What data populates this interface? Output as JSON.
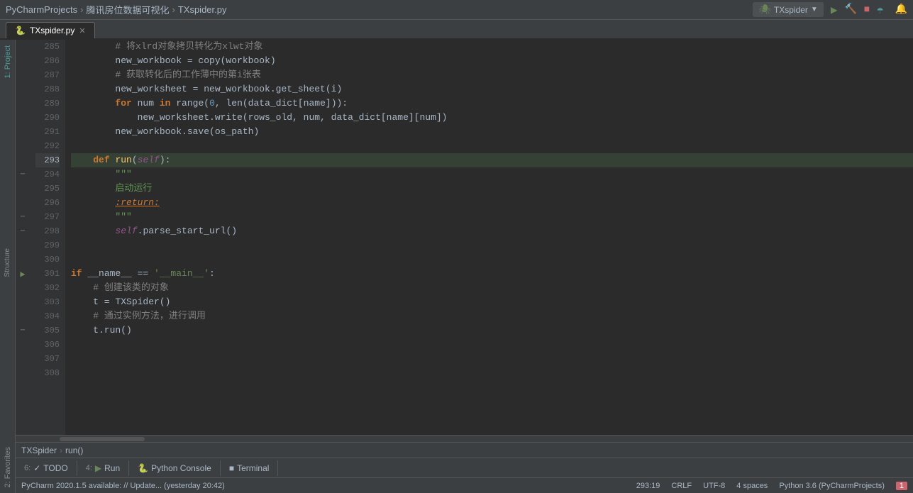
{
  "titlebar": {
    "project": "PyCharmProjects",
    "sep1": "›",
    "folder": "腾讯房位数据可视化",
    "sep2": "›",
    "file": "TXspider.py",
    "run_config_label": "TXspider",
    "run_icon": "▶",
    "build_icon": "🔨",
    "stop_icon": "⏹",
    "coverage_icon": "☂"
  },
  "tabs": [
    {
      "label": "TXspider.py",
      "icon": "🐍",
      "active": true
    }
  ],
  "editor": {
    "lines": [
      {
        "num": 285,
        "content": [
          {
            "t": "        ",
            "c": ""
          },
          {
            "t": "# 将xlrd对象拷贝转化为xlwt对象",
            "c": "comment"
          }
        ],
        "fold": false,
        "run": false
      },
      {
        "num": 286,
        "content": [
          {
            "t": "        new_workbook = copy(workbook)",
            "c": "var"
          }
        ],
        "fold": false,
        "run": false
      },
      {
        "num": 287,
        "content": [
          {
            "t": "        ",
            "c": ""
          },
          {
            "t": "# 获取转化后的工作薄中的第i张表",
            "c": "comment"
          }
        ],
        "fold": false,
        "run": false
      },
      {
        "num": 288,
        "content": [
          {
            "t": "        new_worksheet = new_workbook.get_sheet(i)",
            "c": "var"
          }
        ],
        "fold": false,
        "run": false
      },
      {
        "num": 289,
        "content": [
          {
            "t": "        ",
            "c": ""
          },
          {
            "t": "for",
            "c": "kw"
          },
          {
            "t": " num ",
            "c": "var"
          },
          {
            "t": "in",
            "c": "kw"
          },
          {
            "t": " range(",
            "c": "var"
          },
          {
            "t": "0",
            "c": "num"
          },
          {
            "t": ", len(data_dict[name])):",
            "c": "var"
          }
        ],
        "fold": false,
        "run": false
      },
      {
        "num": 290,
        "content": [
          {
            "t": "            new_worksheet.write(rows_old, num, data_dict[name][num])",
            "c": "var"
          }
        ],
        "fold": false,
        "run": false
      },
      {
        "num": 291,
        "content": [
          {
            "t": "        new_workbook.save(os_path)",
            "c": "var"
          }
        ],
        "fold": false,
        "run": false
      },
      {
        "num": 292,
        "content": [
          {
            "t": "",
            "c": ""
          }
        ],
        "fold": false,
        "run": false
      },
      {
        "num": 293,
        "content": [
          {
            "t": "    ",
            "c": ""
          },
          {
            "t": "def",
            "c": "kw"
          },
          {
            "t": " ",
            "c": ""
          },
          {
            "t": "run",
            "c": "fn"
          },
          {
            "t": "(",
            "c": "var"
          },
          {
            "t": "self",
            "c": "self-kw"
          },
          {
            "t": "):",
            "c": "var"
          }
        ],
        "fold": false,
        "run": false,
        "highlighted": true
      },
      {
        "num": 294,
        "content": [
          {
            "t": "        \"\"\"",
            "c": "docstring"
          }
        ],
        "fold": true,
        "run": false
      },
      {
        "num": 295,
        "content": [
          {
            "t": "        启动运行",
            "c": "docstring"
          }
        ],
        "fold": false,
        "run": false
      },
      {
        "num": 296,
        "content": [
          {
            "t": "        ",
            "c": ""
          },
          {
            "t": ":return:",
            "c": "ret"
          }
        ],
        "fold": false,
        "run": false
      },
      {
        "num": 297,
        "content": [
          {
            "t": "        \"\"\"",
            "c": "docstring"
          }
        ],
        "fold": true,
        "run": false
      },
      {
        "num": 298,
        "content": [
          {
            "t": "        ",
            "c": ""
          },
          {
            "t": "self",
            "c": "self-kw"
          },
          {
            "t": ".parse_start_url()",
            "c": "var"
          }
        ],
        "fold": true,
        "run": false
      },
      {
        "num": 299,
        "content": [
          {
            "t": "",
            "c": ""
          }
        ],
        "fold": false,
        "run": false
      },
      {
        "num": 300,
        "content": [
          {
            "t": "",
            "c": ""
          }
        ],
        "fold": false,
        "run": false
      },
      {
        "num": 301,
        "content": [
          {
            "t": "if",
            "c": "kw"
          },
          {
            "t": " __name__ == ",
            "c": "var"
          },
          {
            "t": "'__main__'",
            "c": "str"
          },
          {
            "t": ":",
            "c": "var"
          }
        ],
        "fold": false,
        "run": true
      },
      {
        "num": 302,
        "content": [
          {
            "t": "    ",
            "c": ""
          },
          {
            "t": "# 创建该类的对象",
            "c": "comment"
          }
        ],
        "fold": false,
        "run": false
      },
      {
        "num": 303,
        "content": [
          {
            "t": "    t = TXSpider()",
            "c": "var"
          }
        ],
        "fold": false,
        "run": false
      },
      {
        "num": 304,
        "content": [
          {
            "t": "    ",
            "c": ""
          },
          {
            "t": "# 通过实例方法，进行调用",
            "c": "comment"
          }
        ],
        "fold": false,
        "run": false
      },
      {
        "num": 305,
        "content": [
          {
            "t": "    t.run()",
            "c": "var"
          }
        ],
        "fold": true,
        "run": false
      },
      {
        "num": 306,
        "content": [
          {
            "t": "",
            "c": ""
          }
        ],
        "fold": false,
        "run": false
      },
      {
        "num": 307,
        "content": [
          {
            "t": "",
            "c": ""
          }
        ],
        "fold": false,
        "run": false
      },
      {
        "num": 308,
        "content": [
          {
            "t": "",
            "c": ""
          }
        ],
        "fold": false,
        "run": false
      }
    ],
    "active_line": 293
  },
  "breadcrumb": {
    "items": [
      "TXSpider",
      "›",
      "run()"
    ]
  },
  "bottom_tabs": [
    {
      "num": "6:",
      "icon": "✓",
      "label": "TODO",
      "active": false
    },
    {
      "num": "4:",
      "icon": "▶",
      "label": "Run",
      "active": false
    },
    {
      "icon": "🐍",
      "label": "Python Console",
      "active": false
    },
    {
      "icon": "■",
      "label": "Terminal",
      "active": false
    }
  ],
  "status_bar": {
    "message": "PyCharm 2020.1.5 available: // Update... (yesterday 20:42)",
    "position": "293:19",
    "line_endings": "CRLF",
    "encoding": "UTF-8",
    "indent": "4 spaces",
    "python": "Python 3.6 (PyCharmProjects)",
    "notifications": "1"
  },
  "sidebar_panels": {
    "left": [
      "1: Project",
      "2: Favorites"
    ],
    "right": []
  }
}
